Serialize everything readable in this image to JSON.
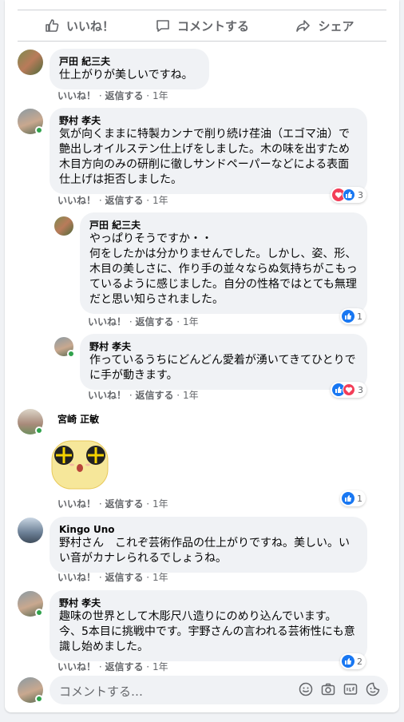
{
  "actions": {
    "like": "いいね！",
    "comment": "コメントする",
    "share": "シェア"
  },
  "meta_labels": {
    "like": "いいね！",
    "reply": "返信する",
    "time": "1年"
  },
  "comments": [
    {
      "author": "戸田 紀三夫",
      "text": "仕上がりが美しいですね。"
    },
    {
      "author": "野村 孝夫",
      "text": "気が向くままに特製カンナで削り続け荏油（エゴマ油）で艶出しオイルステン仕上げをしました。木の味を出すため木目方向のみの研削に徹しサンドペーパーなどによる表面仕上げは拒否しました。",
      "reaction_count": "3"
    },
    {
      "author": "戸田 紀三夫",
      "text": "やっぱりそうですか・・\n何をしたかは分かりませんでした。しかし、姿、形、木目の美しさに、作り手の並々ならぬ気持ちがこもっているように感じました。自分の性格ではとても無理だと思い知らされました。",
      "reaction_count": "1"
    },
    {
      "author": "野村 孝夫",
      "text": "作っているうちにどんどん愛着が湧いてきてひとりでに手が動きます。",
      "reaction_count": "3"
    },
    {
      "author": "宮崎 正敏",
      "sticker": "sunglasses-smiley-sticker",
      "reaction_count": "1"
    },
    {
      "author": "Kingo Uno",
      "text": "野村さん　これぞ芸術作品の仕上がりですね。美しい。いい音がカナレられるでしょうね。"
    },
    {
      "author": "野村 孝夫",
      "text": "趣味の世界として木彫尺八造りにのめり込んでいます。今、5本目に挑戦中です。宇野さんの言われる芸術性にも意識し始めました。",
      "reaction_count": "2"
    }
  ],
  "composer": {
    "placeholder": "コメントする…"
  },
  "colors": {
    "like": "#1877f2",
    "love": "#f33e58",
    "online": "#31a24c",
    "bubble": "#f0f2f5"
  }
}
